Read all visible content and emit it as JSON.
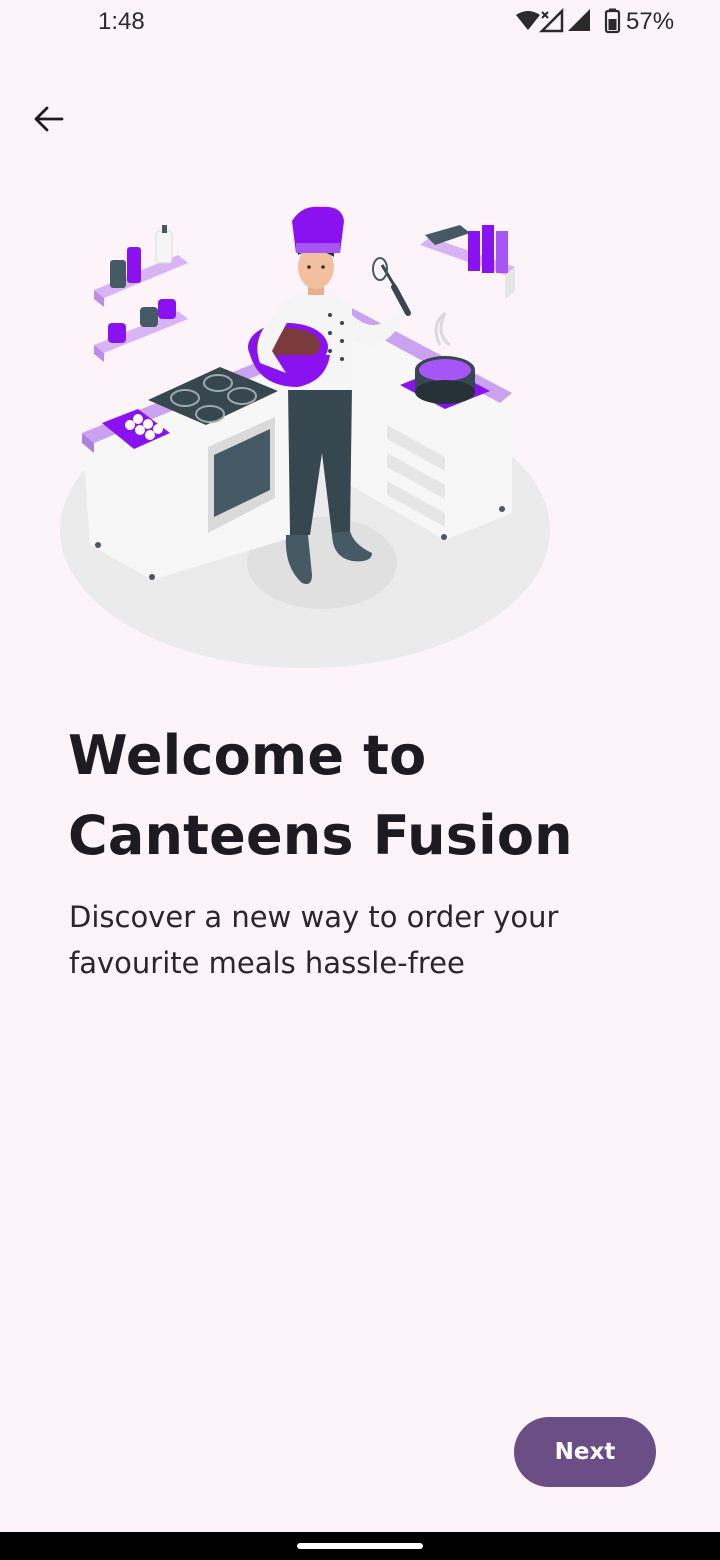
{
  "status_bar": {
    "time": "1:48",
    "battery_percent": "57%",
    "icons": [
      "wifi-icon",
      "no-data-signal-icon",
      "signal-icon",
      "battery-icon"
    ]
  },
  "header": {
    "back_icon": "arrow-left-icon"
  },
  "illustration": {
    "subject": "chef-in-kitchen-illustration",
    "accent_color": "#8A12F1"
  },
  "onboarding": {
    "title_line1": "Welcome to",
    "title_line2": "Canteens Fusion",
    "subtitle_line1": "Discover a new way to order your",
    "subtitle_line2": "favourite meals hassle-free",
    "next_label": "Next"
  },
  "colors": {
    "background": "#FDF4FA",
    "button": "#6C4E86",
    "text": "#1E1A22"
  }
}
